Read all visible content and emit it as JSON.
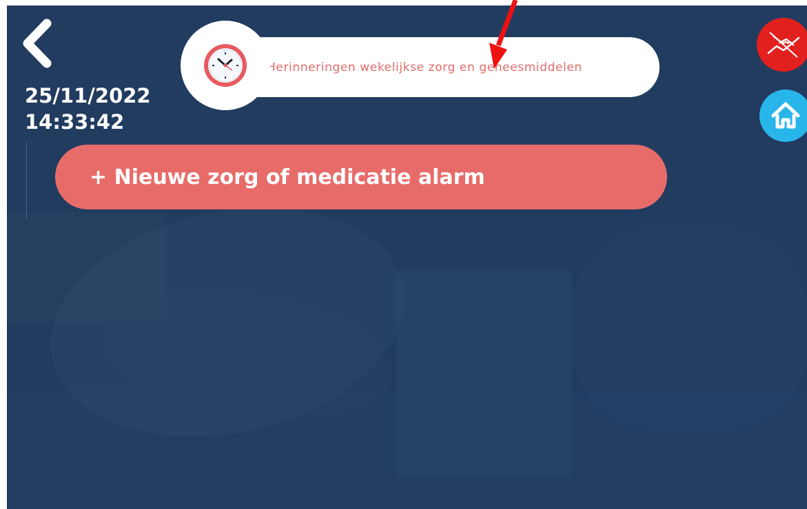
{
  "header": {
    "title": "Herinneringen wekelijkse zorg en geneesmiddelen",
    "date": "25/11/2022",
    "time": "14:33:42"
  },
  "actions": {
    "new_alarm_label": "+ Nieuwe zorg of medicatie alarm"
  },
  "icons": {
    "back": "chevron-left-icon",
    "clock": "alarm-clock-icon",
    "help": "helping-hands-icon",
    "home": "home-icon",
    "annotation": "red-arrow-icon"
  },
  "colors": {
    "background": "#223c5f",
    "accent": "#e76c69",
    "title_text": "#e26b68",
    "help": "#e2201e",
    "home": "#28b6ea"
  }
}
